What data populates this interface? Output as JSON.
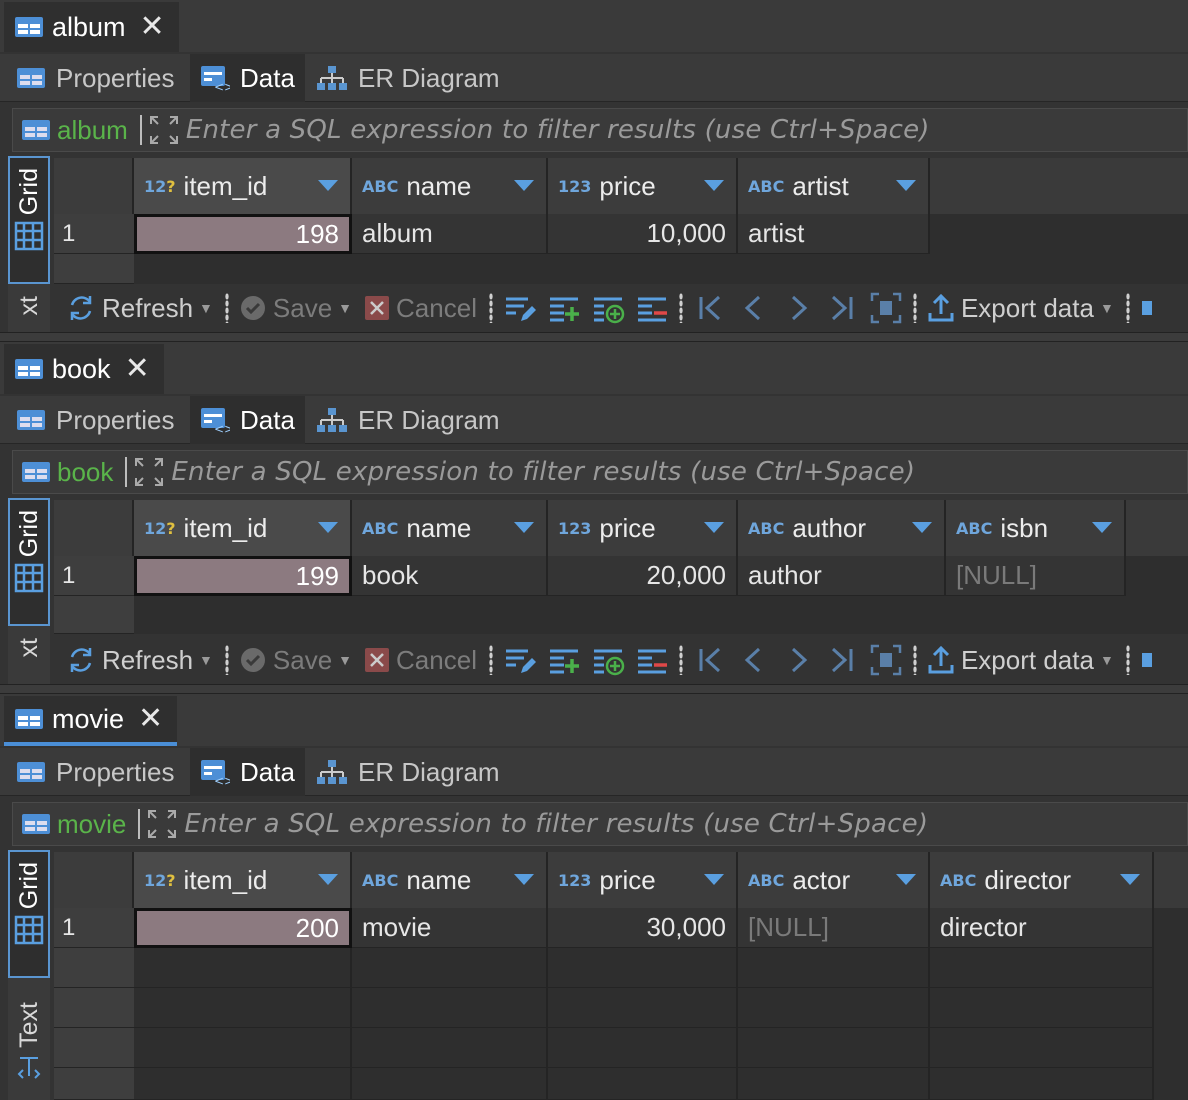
{
  "colors": {
    "accent": "#4a8ed6",
    "table_name": "#5ab44a",
    "selected_cell": "#8c7a80",
    "null_text": "#7a7a7a"
  },
  "filter_placeholder": "Enter a SQL expression to filter results (use Ctrl+Space)",
  "subtabs": {
    "properties": "Properties",
    "data": "Data",
    "er": "ER Diagram"
  },
  "side": {
    "grid": "Grid",
    "text": "Text",
    "text_cut": "xt"
  },
  "toolbar": {
    "refresh": "Refresh",
    "save": "Save",
    "cancel": "Cancel",
    "export": "Export data"
  },
  "type_labels": {
    "num": "123",
    "abc": "ABC",
    "key": "12"
  },
  "panels": [
    {
      "tab": "album",
      "table_name": "album",
      "columns": [
        "item_id",
        "name",
        "price",
        "artist"
      ],
      "row": {
        "num": "1",
        "item_id": "198",
        "name": "album",
        "price": "10,000",
        "c4": "artist"
      }
    },
    {
      "tab": "book",
      "table_name": "book",
      "columns": [
        "item_id",
        "name",
        "price",
        "author",
        "isbn"
      ],
      "row": {
        "num": "1",
        "item_id": "199",
        "name": "book",
        "price": "20,000",
        "c4": "author",
        "c5": "[NULL]"
      }
    },
    {
      "tab": "movie",
      "table_name": "movie",
      "columns": [
        "item_id",
        "name",
        "price",
        "actor",
        "director"
      ],
      "row": {
        "num": "1",
        "item_id": "200",
        "name": "movie",
        "price": "30,000",
        "c4": "[NULL]",
        "c5": "director"
      }
    }
  ]
}
